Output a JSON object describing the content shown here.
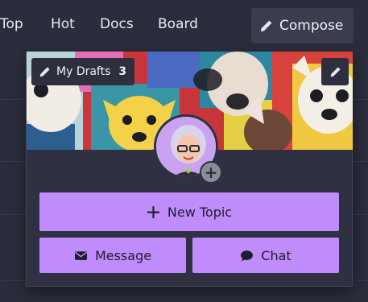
{
  "nav": {
    "items": [
      {
        "label": "Top"
      },
      {
        "label": "Hot"
      },
      {
        "label": "Docs"
      },
      {
        "label": "Board"
      }
    ],
    "compose_label": "Compose"
  },
  "menu": {
    "drafts_label": "My Drafts",
    "drafts_count": "3",
    "new_topic_label": "New Topic",
    "message_label": "Message",
    "chat_label": "Chat"
  },
  "icons": {
    "compose": "pencil-icon",
    "drafts": "pencil-icon",
    "edit_banner": "pencil-icon",
    "new_topic": "plus-icon",
    "message": "envelope-icon",
    "chat": "chat-bubble-icon",
    "avatar_add": "plus-icon"
  },
  "colors": {
    "background": "#2b2d3c",
    "accent": "#c08cfb",
    "button_text": "#1d1e2a"
  }
}
